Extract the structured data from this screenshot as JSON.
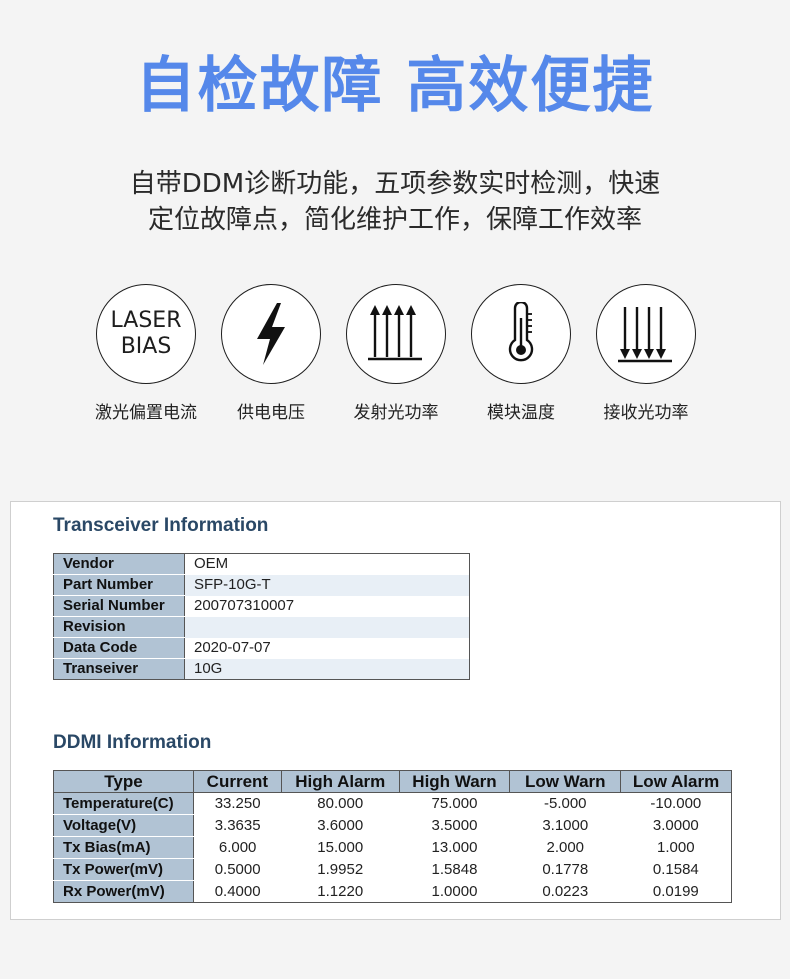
{
  "headline": "自检故障 高效便捷",
  "subtitle": {
    "line1": "自带DDM诊断功能，五项参数实时检测，快速",
    "line2": "定位故障点，简化维护工作，保障工作效率"
  },
  "features": [
    {
      "icon": "laser-bias-icon",
      "icon_text_1": "LASER",
      "icon_text_2": "BIAS",
      "label": "激光偏置电流"
    },
    {
      "icon": "lightning-bolt-icon",
      "label": "供电电压"
    },
    {
      "icon": "arrows-up-icon",
      "label": "发射光功率"
    },
    {
      "icon": "thermometer-icon",
      "label": "模块温度"
    },
    {
      "icon": "arrows-down-icon",
      "label": "接收光功率"
    }
  ],
  "transceiver": {
    "title": "Transceiver Information",
    "rows": [
      {
        "key": "Vendor",
        "value": "OEM"
      },
      {
        "key": "Part Number",
        "value": "SFP-10G-T"
      },
      {
        "key": "Serial Number",
        "value": "200707310007"
      },
      {
        "key": "Revision",
        "value": ""
      },
      {
        "key": "Data Code",
        "value": "2020-07-07"
      },
      {
        "key": "Transeiver",
        "value": "10G"
      }
    ]
  },
  "ddmi": {
    "title": "DDMI Information",
    "headers": [
      "Type",
      "Current",
      "High Alarm",
      "High Warn",
      "Low Warn",
      "Low Alarm"
    ],
    "rows": [
      [
        "Temperature(C)",
        "33.250",
        "80.000",
        "75.000",
        "-5.000",
        "-10.000"
      ],
      [
        "Voltage(V)",
        "3.3635",
        "3.6000",
        "3.5000",
        "3.1000",
        "3.0000"
      ],
      [
        "Tx Bias(mA)",
        "6.000",
        "15.000",
        "13.000",
        "2.000",
        "1.000"
      ],
      [
        "Tx Power(mV)",
        "0.5000",
        "1.9952",
        "1.5848",
        "0.1778",
        "0.1584"
      ],
      [
        "Rx Power(mV)",
        "0.4000",
        "1.1220",
        "1.0000",
        "0.0223",
        "0.0199"
      ]
    ]
  }
}
